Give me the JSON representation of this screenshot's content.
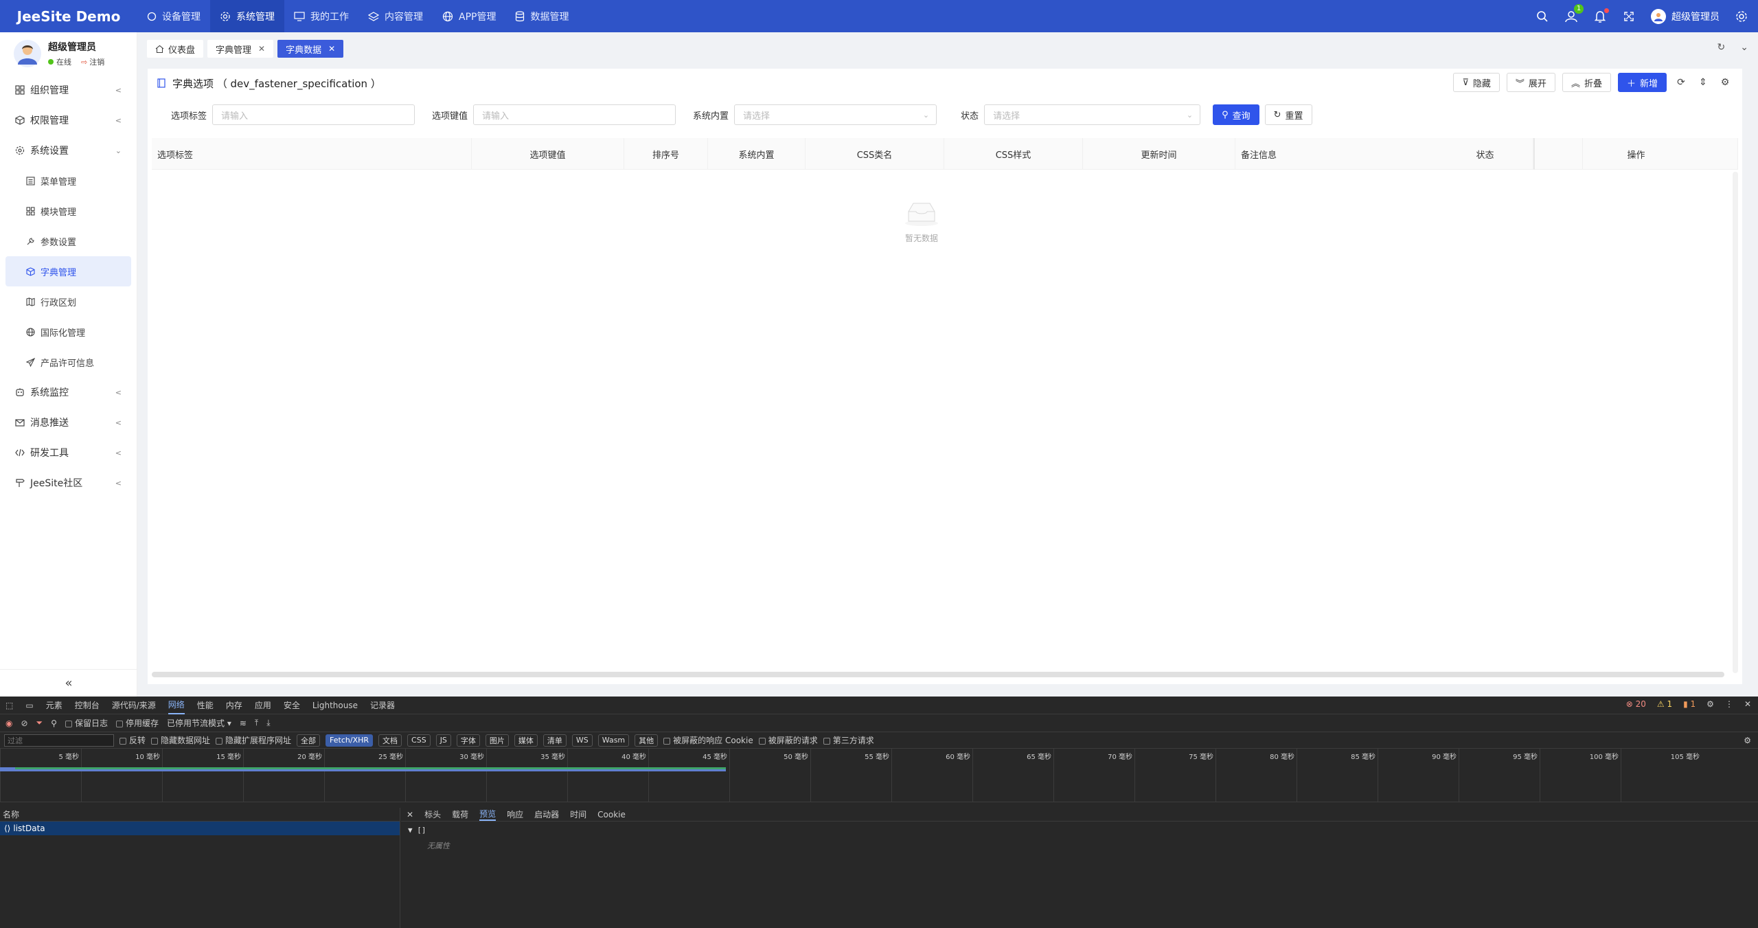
{
  "app": {
    "brand": "JeeSite Demo"
  },
  "topnav": [
    {
      "label": "设备管理",
      "icon": "circle-icon"
    },
    {
      "label": "系统管理",
      "icon": "gear-icon",
      "active": true
    },
    {
      "label": "我的工作",
      "icon": "monitor-icon"
    },
    {
      "label": "内容管理",
      "icon": "layers-icon"
    },
    {
      "label": "APP管理",
      "icon": "globe-icon"
    },
    {
      "label": "数据管理",
      "icon": "database-icon"
    }
  ],
  "topright": {
    "msg_count": "1",
    "user": "超级管理员"
  },
  "profile": {
    "name": "超级管理员",
    "online": "在线",
    "logout": "注销"
  },
  "menu": {
    "org": "组织管理",
    "perm": "权限管理",
    "sys": "系统设置",
    "sub": [
      "菜单管理",
      "模块管理",
      "参数设置",
      "字典管理",
      "行政区划",
      "国际化管理",
      "产品许可信息"
    ],
    "monitor": "系统监控",
    "msg": "消息推送",
    "dev": "研发工具",
    "community": "JeeSite社区"
  },
  "tabs": [
    {
      "label": "仪表盘"
    },
    {
      "label": "字典管理"
    },
    {
      "label": "字典数据",
      "active": true
    }
  ],
  "card": {
    "title": "字典选项 （ dev_fastener_specification ）",
    "actions": {
      "hide": "隐藏",
      "expand": "展开",
      "collapse": "折叠",
      "add": "新增"
    }
  },
  "filters": {
    "label1": "选项标签",
    "ph1": "请输入",
    "label2": "选项键值",
    "ph2": "请输入",
    "label3": "系统内置",
    "ph3": "请选择",
    "label4": "状态",
    "ph4": "请选择",
    "search": "查询",
    "reset": "重置"
  },
  "table": {
    "columns": [
      "选项标签",
      "选项键值",
      "排序号",
      "系统内置",
      "CSS类名",
      "CSS样式",
      "更新时间",
      "备注信息",
      "状态",
      "操作"
    ],
    "empty": "暂无数据"
  },
  "devtools": {
    "tabs": [
      "元素",
      "控制台",
      "源代码/来源",
      "网络",
      "性能",
      "内存",
      "应用",
      "安全",
      "Lighthouse",
      "记录器"
    ],
    "errors": "20",
    "warnings": "1",
    "issues": "1",
    "toolbar": {
      "preserve": "保留日志",
      "cache": "停用缓存",
      "throttle": "已停用节流模式"
    },
    "filter": {
      "placeholder": "过滤",
      "invert": "反转",
      "hide_data": "隐藏数据网址",
      "hide_ext": "隐藏扩展程序网址",
      "chips": [
        "全部",
        "Fetch/XHR",
        "文档",
        "CSS",
        "JS",
        "字体",
        "图片",
        "媒体",
        "清单",
        "WS",
        "Wasm",
        "其他"
      ],
      "blocked_resp": "被屏蔽的响应 Cookie",
      "blocked_req": "被屏蔽的请求",
      "third_party": "第三方请求"
    },
    "ticks": [
      "5 毫秒",
      "10 毫秒",
      "15 毫秒",
      "20 毫秒",
      "25 毫秒",
      "30 毫秒",
      "35 毫秒",
      "40 毫秒",
      "45 毫秒",
      "50 毫秒",
      "55 毫秒",
      "60 毫秒",
      "65 毫秒",
      "70 毫秒",
      "75 毫秒",
      "80 毫秒",
      "85 毫秒",
      "90 毫秒",
      "95 毫秒",
      "100 毫秒",
      "105 毫秒"
    ],
    "names_header": "名称",
    "request": "listData",
    "detail_tabs": [
      "标头",
      "载荷",
      "预览",
      "响应",
      "启动器",
      "时间",
      "Cookie"
    ],
    "preview_root": "▼ []",
    "preview_empty": "无属性"
  }
}
